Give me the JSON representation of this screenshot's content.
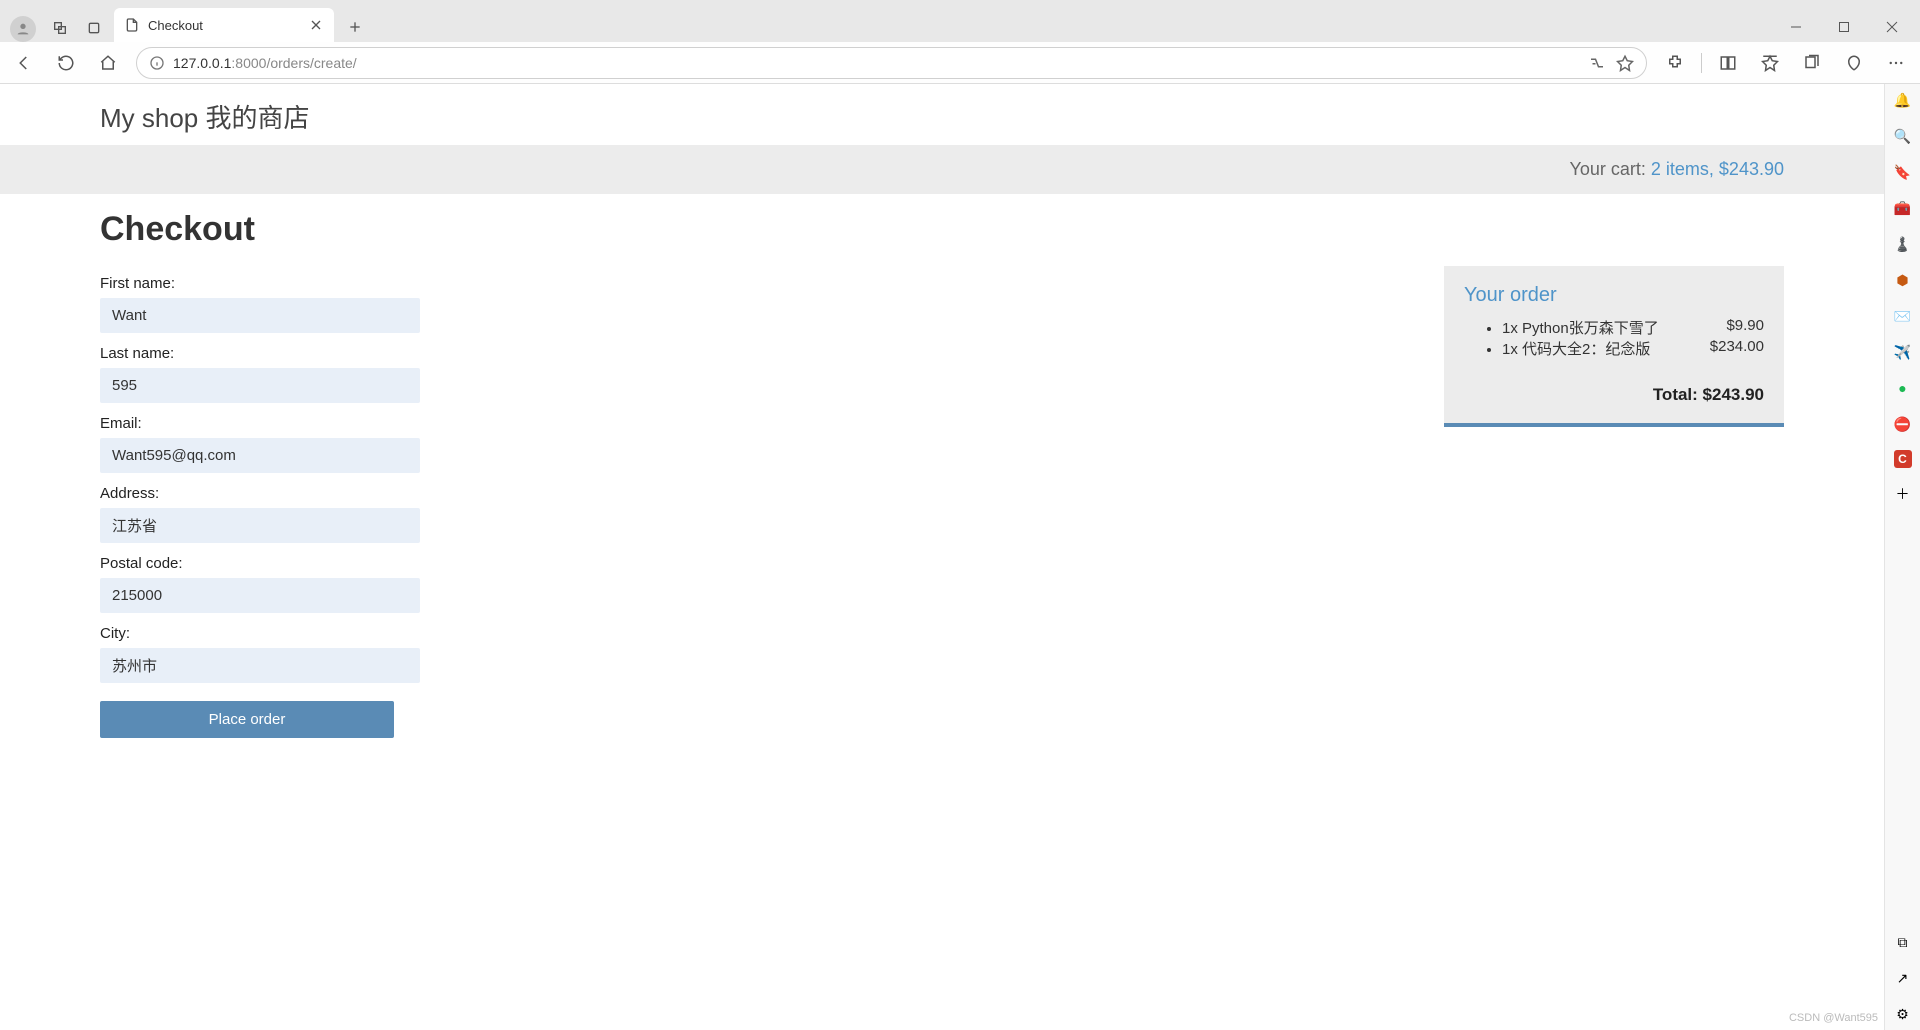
{
  "browser": {
    "tab_title": "Checkout",
    "url_host": "127.0.0.1",
    "url_port": ":8000",
    "url_path": "/orders/create/"
  },
  "shop": {
    "title": "My shop 我的商店",
    "cart_label": "Your cart: ",
    "cart_link": "2 items, $243.90"
  },
  "page": {
    "heading": "Checkout",
    "labels": {
      "first_name": "First name:",
      "last_name": "Last name:",
      "email": "Email:",
      "address": "Address:",
      "postal_code": "Postal code:",
      "city": "City:"
    },
    "values": {
      "first_name": "Want",
      "last_name": "595",
      "email": "Want595@qq.com",
      "address": "江苏省",
      "postal_code": "215000",
      "city": "苏州市"
    },
    "submit": "Place order"
  },
  "order": {
    "heading": "Your order",
    "items": [
      {
        "line": "1x Python张万森下雪了",
        "price": "$9.90"
      },
      {
        "line": "1x 代码大全2：纪念版",
        "price": "$234.00"
      }
    ],
    "total_label": "Total: ",
    "total_value": "$243.90"
  },
  "watermark": "CSDN @Want595"
}
